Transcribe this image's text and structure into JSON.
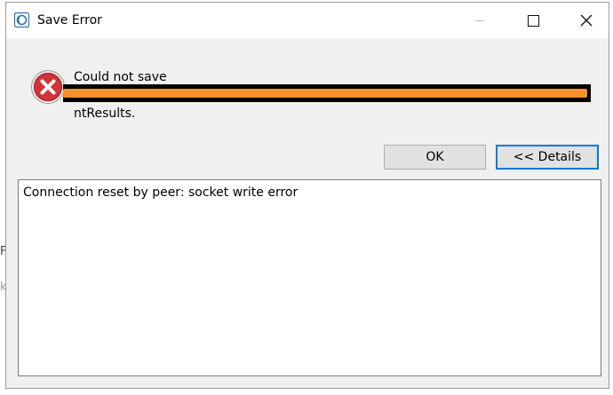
{
  "window": {
    "title": "Save Error"
  },
  "titlebar_buttons": {
    "minimize": "minimize",
    "maximize": "maximize",
    "close": "close"
  },
  "message": {
    "line1": "Could not save",
    "line2": "ntResults.",
    "redacted": true
  },
  "buttons": {
    "ok_label": "OK",
    "details_label": "<< Details"
  },
  "details": {
    "text": "Connection reset by peer: socket write error"
  },
  "colors": {
    "error_red": "#d13438",
    "focus_blue": "#0078d7",
    "redaction_orange": "#f3922f"
  },
  "icons": {
    "app": "app-logo-icon",
    "error": "error-x-icon"
  }
}
